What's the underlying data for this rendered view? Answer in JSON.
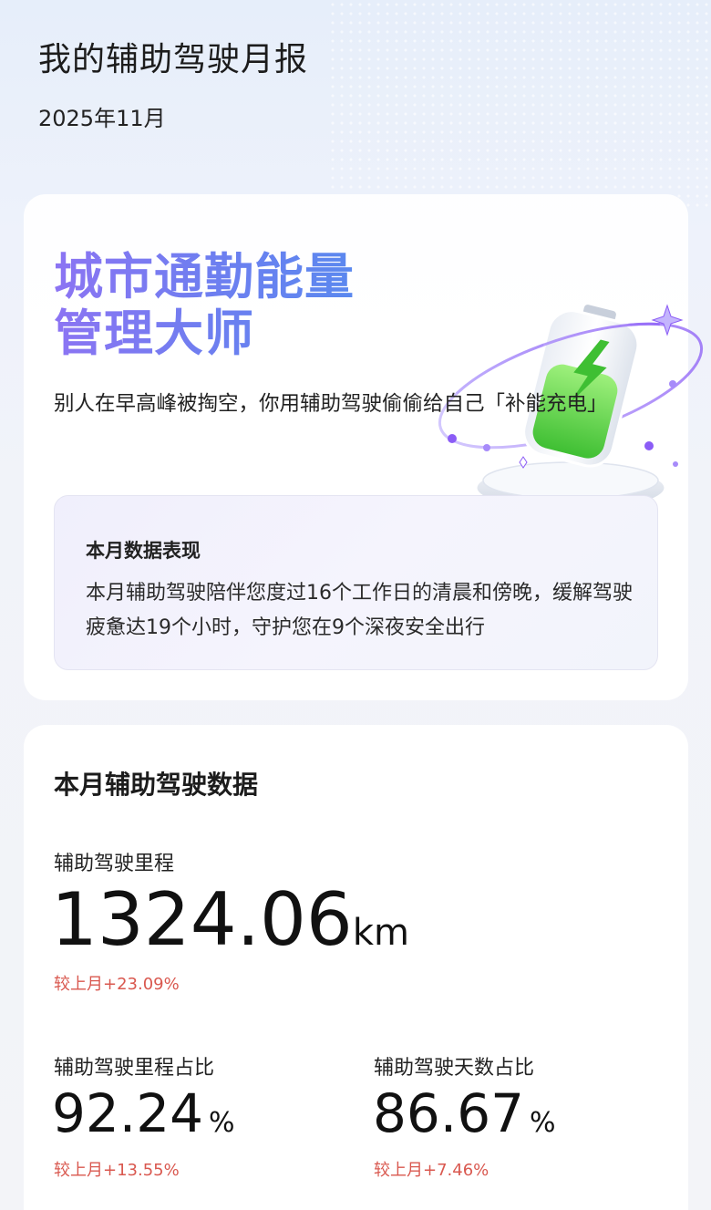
{
  "header": {
    "title": "我的辅助驾驶月报",
    "date": "2025年11月"
  },
  "hero": {
    "title_line1": "城市通勤能量",
    "title_line2": "管理大师",
    "description": "别人在早高峰被掏空，你用辅助驾驶偷偷给自己「补能充电」",
    "illustration": "battery-charging-icon",
    "summary": {
      "heading": "本月数据表现",
      "body": "本月辅助驾驶陪伴您度过16个工作日的清晨和傍晚，缓解驾驶疲惫达19个小时，守护您在9个深夜安全出行"
    }
  },
  "stats": {
    "heading": "本月辅助驾驶数据",
    "mileage": {
      "label": "辅助驾驶里程",
      "value": "1324.06",
      "unit": "km",
      "change": "较上月+23.09%"
    },
    "mileage_ratio": {
      "label": "辅助驾驶里程占比",
      "value": "92.24",
      "unit": "%",
      "change": "较上月+13.55%"
    },
    "days_ratio": {
      "label": "辅助驾驶天数占比",
      "value": "86.67",
      "unit": "%",
      "change": "较上月+7.46%"
    }
  },
  "colors": {
    "title_gradient_start": "#8c74f3",
    "title_gradient_end": "#5a88ef",
    "change_positive": "#d9584f",
    "battery_green": "#5fd34a",
    "ring_purple": "#a78bfa"
  }
}
